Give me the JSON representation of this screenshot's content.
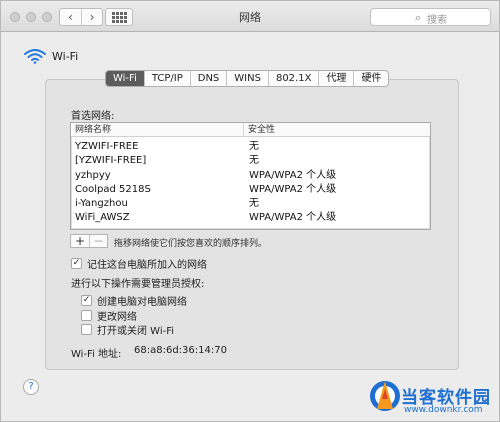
{
  "window": {
    "title": "网络",
    "search_placeholder": "搜索",
    "search_icon": "magnifier-icon",
    "nav_back_icon": "chevron-left-icon",
    "nav_forward_icon": "chevron-right-icon",
    "grid_icon": "show-all-grid-icon"
  },
  "header": {
    "icon": "wifi-icon",
    "label": "Wi-Fi"
  },
  "tabs": [
    {
      "label": "Wi-Fi",
      "active": true
    },
    {
      "label": "TCP/IP",
      "active": false
    },
    {
      "label": "DNS",
      "active": false
    },
    {
      "label": "WINS",
      "active": false
    },
    {
      "label": "802.1X",
      "active": false
    },
    {
      "label": "代理",
      "active": false
    },
    {
      "label": "硬件",
      "active": false
    }
  ],
  "preferred": {
    "label": "首选网络:",
    "columns": [
      "网络名称",
      "安全性"
    ],
    "rows": [
      {
        "name": "YZWIFI-FREE",
        "security": "无"
      },
      {
        "name": "[YZWIFI-FREE]",
        "security": "无"
      },
      {
        "name": "yzhpyy",
        "security": "WPA/WPA2 个人级"
      },
      {
        "name": "Coolpad 5218S",
        "security": "WPA/WPA2 个人级"
      },
      {
        "name": "i-Yangzhou",
        "security": "无"
      },
      {
        "name": "WiFi_AWSZ",
        "security": "WPA/WPA2 个人级"
      }
    ],
    "add_label": "+",
    "remove_label": "−",
    "hint": "拖移网络使它们按您喜欢的顺序排列。"
  },
  "options": {
    "remember": {
      "label": "记住这台电脑所加入的网络",
      "checked": true
    },
    "admin_label": "进行以下操作需要管理员授权:",
    "create": {
      "label": "创建电脑对电脑网络",
      "checked": true
    },
    "change": {
      "label": "更改网络",
      "checked": false
    },
    "toggle": {
      "label": "打开或关闭 Wi-Fi",
      "checked": false
    },
    "check_mark": "✓"
  },
  "address": {
    "label": "Wi-Fi 地址:",
    "value": "68:a8:6d:36:14:70"
  },
  "help": {
    "label": "?"
  },
  "watermark": {
    "title": "当客软件园",
    "url": "www.downkr.com"
  },
  "colors": {
    "active_tab": "#5c5c5c",
    "watermark": "#1e6fd1"
  }
}
